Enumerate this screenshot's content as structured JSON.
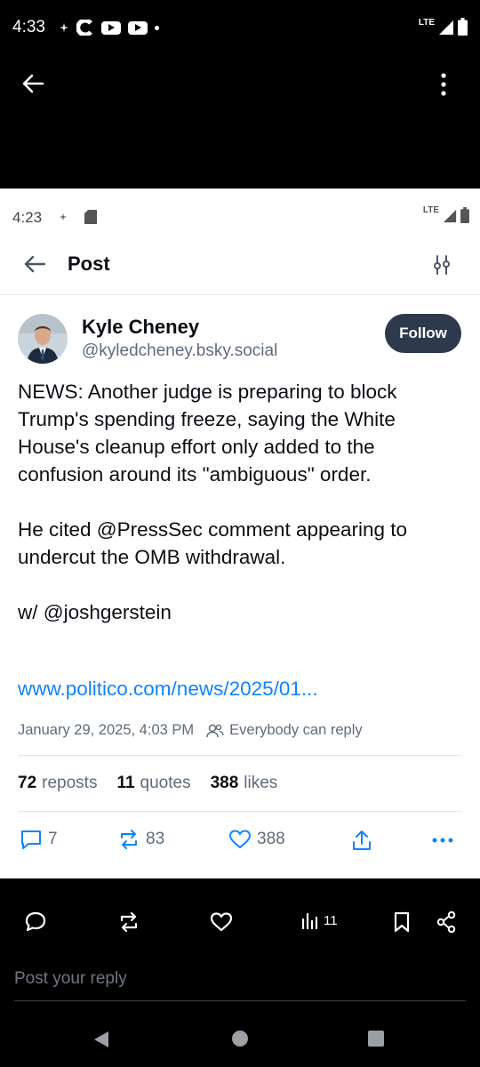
{
  "outer_status": {
    "time": "4:33",
    "network": "LTE"
  },
  "inner_status": {
    "time": "4:23",
    "network": "LTE"
  },
  "header": {
    "title": "Post"
  },
  "author": {
    "name": "Kyle Cheney",
    "handle": "@kyledcheney.bsky.social",
    "follow_label": "Follow"
  },
  "post": {
    "text": "NEWS: Another judge is preparing to block Trump's spending freeze, saying the White House's cleanup effort only added to the confusion around its \"ambiguous\" order.\n\nHe cited @PressSec comment appearing to undercut the OMB withdrawal.\n\nw/ @joshgerstein",
    "link": "www.politico.com/news/2025/01...",
    "timestamp": "January 29, 2025, 4:03 PM",
    "reply_setting": "Everybody can reply"
  },
  "stats": {
    "reposts_count": "72",
    "reposts_label": "reposts",
    "quotes_count": "11",
    "quotes_label": "quotes",
    "likes_count": "388",
    "likes_label": "likes"
  },
  "actions": {
    "replies": "7",
    "reposts": "83",
    "likes": "388"
  },
  "outer_toolbar": {
    "views": "11"
  },
  "reply_box": {
    "placeholder": "Post your reply"
  },
  "colors": {
    "accent": "#1083fe",
    "follow_bg": "#2e3a4c",
    "muted": "#5f6b7a"
  }
}
